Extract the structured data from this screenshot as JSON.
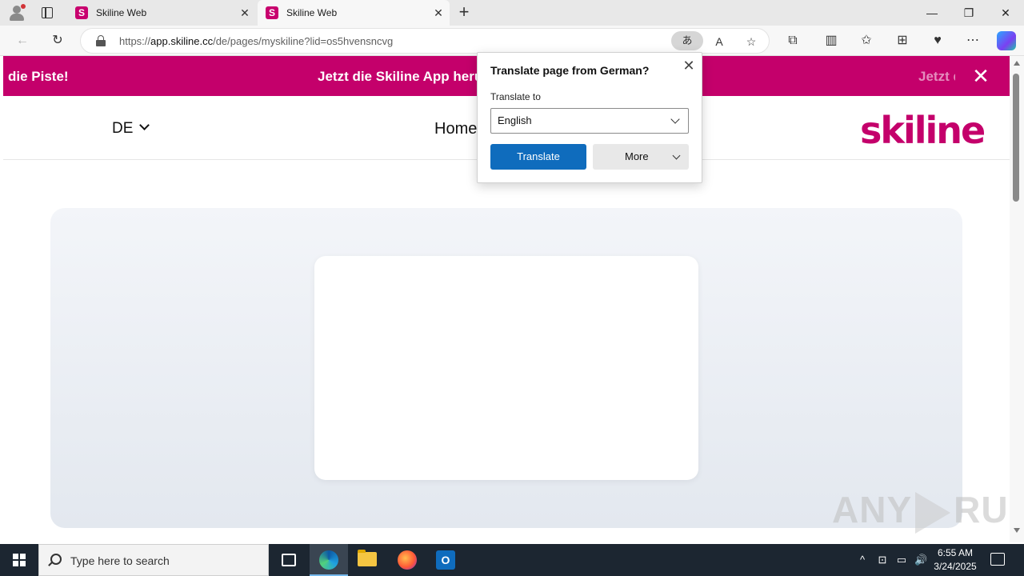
{
  "browser": {
    "tabs": [
      {
        "favicon": "S",
        "title": "Skiline Web",
        "active": false
      },
      {
        "favicon": "S",
        "title": "Skiline Web",
        "active": true
      }
    ],
    "url_prefix": "https://",
    "url_domain": "app.skiline.cc",
    "url_path": "/de/pages/myskiline?lid=os5hvensncvg",
    "translate_pill": "あ",
    "read_aloud": "A",
    "window_controls": {
      "minimize": "—",
      "restore": "❐",
      "close": "✕"
    },
    "icons": {
      "back": "←",
      "refresh": "↻",
      "favorite": "☆",
      "extensions": "⧉",
      "split": "▥",
      "favorites": "✩",
      "collections": "⊞",
      "performance": "♥",
      "more": "⋯"
    }
  },
  "banner": {
    "marquee_left": "die Piste!",
    "marquee_center": "Jetzt die Skiline App herun",
    "marquee_right_a": "Jetzt ",
    "marquee_right_b": "d",
    "close_glyph": "✕",
    "color": "#c4006b"
  },
  "nav": {
    "language": "DE",
    "home_link": "Home",
    "logo": "skiline"
  },
  "translate_popup": {
    "title": "Translate page from German?",
    "close_glyph": "✕",
    "translate_to_label": "Translate to",
    "selected_language": "English",
    "translate_button": "Translate",
    "more_button": "More",
    "primary_color": "#0f6cbd"
  },
  "watermark": {
    "text_left": "ANY",
    "text_right": "RUN"
  },
  "taskbar": {
    "search_placeholder": "Type here to search",
    "time": "6:55 AM",
    "date": "3/24/2025",
    "outlook_letter": "O",
    "tray": {
      "chevron": "^",
      "meet": "⊡",
      "network": "▭",
      "volume": "🔊"
    }
  }
}
